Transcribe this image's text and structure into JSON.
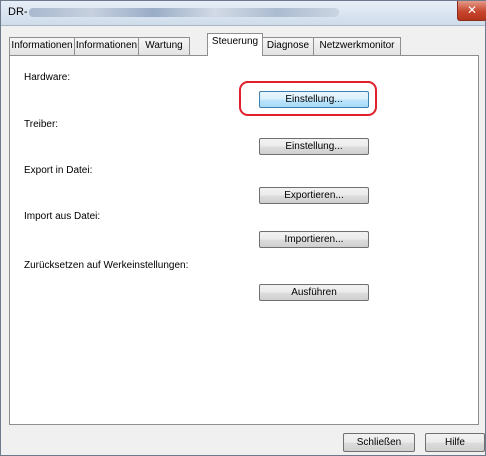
{
  "window": {
    "title_prefix": "DR-",
    "close_glyph": "✕"
  },
  "tabs": [
    {
      "label": "Informationen"
    },
    {
      "label": "Informationen"
    },
    {
      "label": "Wartung"
    },
    {
      "label": "Steuerung"
    },
    {
      "label": "Diagnose"
    },
    {
      "label": "Netzwerkmonitor"
    }
  ],
  "active_tab": "Steuerung",
  "sections": {
    "hardware": {
      "label": "Hardware:",
      "button": "Einstellung..."
    },
    "driver": {
      "label": "Treiber:",
      "button": "Einstellung..."
    },
    "export": {
      "label": "Export in Datei:",
      "button": "Exportieren..."
    },
    "import": {
      "label": "Import aus Datei:",
      "button": "Importieren..."
    },
    "reset": {
      "label": "Zurücksetzen auf Werkeinstellungen:",
      "button": "Ausführen"
    }
  },
  "footer": {
    "close_button": "Schließen",
    "help_button": "Hilfe"
  },
  "colors": {
    "highlight": "#e0202a",
    "close_button": "#c7452c"
  }
}
